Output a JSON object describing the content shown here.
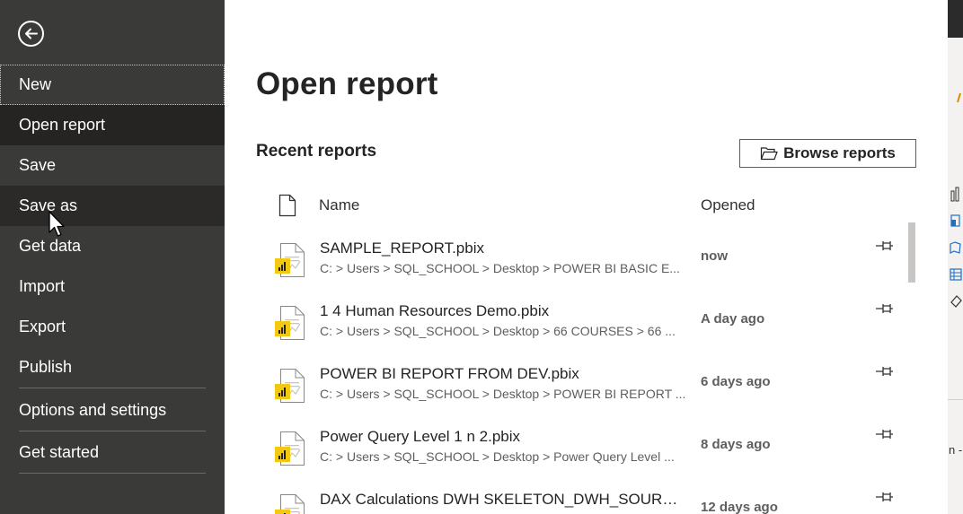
{
  "sidebar": {
    "items": [
      {
        "label": "New"
      },
      {
        "label": "Open report"
      },
      {
        "label": "Save"
      },
      {
        "label": "Save as"
      },
      {
        "label": "Get data"
      },
      {
        "label": "Import"
      },
      {
        "label": "Export"
      },
      {
        "label": "Publish"
      },
      {
        "label": "Options and settings"
      },
      {
        "label": "Get started"
      }
    ],
    "selected": "Open report",
    "hovered": "Save as"
  },
  "main": {
    "title": "Open report",
    "section_title": "Recent reports",
    "browse_label": "Browse reports",
    "columns": {
      "name": "Name",
      "opened": "Opened"
    },
    "reports": [
      {
        "name": "SAMPLE_REPORT.pbix",
        "path": "C: > Users > SQL_SCHOOL > Desktop > POWER BI BASIC E...",
        "opened": "now"
      },
      {
        "name": "1 4 Human Resources Demo.pbix",
        "path": "C: > Users > SQL_SCHOOL > Desktop > 66 COURSES > 66 ...",
        "opened": "A day ago"
      },
      {
        "name": "POWER BI REPORT FROM DEV.pbix",
        "path": "C: > Users > SQL_SCHOOL > Desktop > POWER BI REPORT ...",
        "opened": "6 days ago"
      },
      {
        "name": "Power Query Level 1 n 2.pbix",
        "path": "C: > Users > SQL_SCHOOL > Desktop > Power Query Level ...",
        "opened": "8 days ago"
      },
      {
        "name": "DAX Calculations DWH SKELETON_DWH_SOURCE....",
        "path": "",
        "opened": "12 days ago"
      }
    ]
  },
  "right_edge": {
    "partial_text": "n -"
  },
  "colors": {
    "sidebar_bg": "#3a3a38",
    "sidebar_selected": "#252423",
    "pbix_icon_accent": "#f2c811",
    "text_primary": "#252423",
    "text_secondary": "#605e5c"
  },
  "icons": {
    "back": "back-arrow-circle-icon",
    "file": "document-icon",
    "folder": "folder-open-icon",
    "pin": "pin-icon",
    "pbix": "pbix-file-icon"
  }
}
